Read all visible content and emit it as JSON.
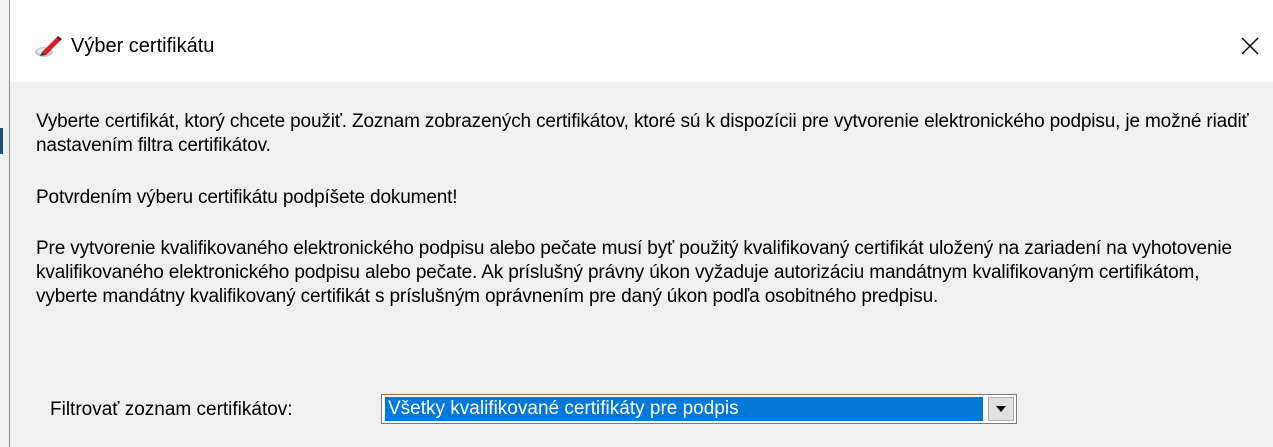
{
  "dialog": {
    "title": "Výber certifikátu",
    "close_label": "✕",
    "title_icon": "pen-certificate-icon"
  },
  "content": {
    "paragraph_1": "Vyberte certifikát, ktorý chcete použiť. Zoznam zobrazených certifikátov, ktoré sú k dispozícii pre vytvorenie elektronického podpisu, je možné riadiť nastavením filtra certifikátov.",
    "paragraph_2": "Potvrdením výberu certifikátu podpíšete dokument!",
    "paragraph_3": "Pre vytvorenie kvalifikovaného elektronického podpisu alebo pečate musí byť použitý kvalifikovaný certifikát uložený na zariadení na vyhotovenie kvalifikovaného elektronického podpisu alebo pečate. Ak príslušný právny úkon vyžaduje autorizáciu mandátnym kvalifikovaným certifikátom, vyberte mandátny kvalifikovaný certifikát s príslušným oprávnením pre daný úkon podľa osobitného predpisu."
  },
  "filter": {
    "label": "Filtrovať zoznam certifikátov:",
    "selected_value": "Všetky kvalifikované certifikáty pre podpis"
  },
  "colors": {
    "selection": "#0078d7",
    "window_bg": "#f0f0f0",
    "titlebar_bg": "#ffffff"
  }
}
